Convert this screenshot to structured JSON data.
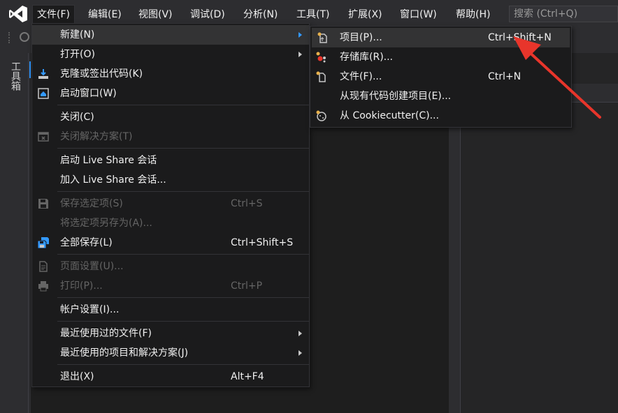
{
  "menubar": {
    "items": [
      "文件(F)",
      "编辑(E)",
      "视图(V)",
      "调试(D)",
      "分析(N)",
      "工具(T)",
      "扩展(X)",
      "窗口(W)",
      "帮助(H)"
    ],
    "search_placeholder": "搜索 (Ctrl+Q)"
  },
  "sidebar": {
    "toolbox_label": "工具箱"
  },
  "file_menu": {
    "items": [
      {
        "label": "新建(N)",
        "shortcut": ""
      },
      {
        "label": "打开(O)",
        "shortcut": ""
      },
      {
        "label": "克隆或签出代码(K)",
        "shortcut": ""
      },
      {
        "label": "启动窗口(W)",
        "shortcut": ""
      },
      {
        "label": "关闭(C)",
        "shortcut": ""
      },
      {
        "label": "关闭解决方案(T)",
        "shortcut": ""
      },
      {
        "label": "启动 Live Share 会话",
        "shortcut": ""
      },
      {
        "label": "加入 Live Share 会话...",
        "shortcut": ""
      },
      {
        "label": "保存选定项(S)",
        "shortcut": "Ctrl+S"
      },
      {
        "label": "将选定项另存为(A)...",
        "shortcut": ""
      },
      {
        "label": "全部保存(L)",
        "shortcut": "Ctrl+Shift+S"
      },
      {
        "label": "页面设置(U)...",
        "shortcut": ""
      },
      {
        "label": "打印(P)...",
        "shortcut": "Ctrl+P"
      },
      {
        "label": "帐户设置(I)...",
        "shortcut": ""
      },
      {
        "label": "最近使用过的文件(F)",
        "shortcut": ""
      },
      {
        "label": "最近使用的项目和解决方案(J)",
        "shortcut": ""
      },
      {
        "label": "退出(X)",
        "shortcut": "Alt+F4"
      }
    ]
  },
  "new_submenu": {
    "items": [
      {
        "label": "项目(P)...",
        "shortcut": "Ctrl+Shift+N"
      },
      {
        "label": "存储库(R)...",
        "shortcut": ""
      },
      {
        "label": "文件(F)...",
        "shortcut": "Ctrl+N"
      },
      {
        "label": "从现有代码创建项目(E)...",
        "shortcut": ""
      },
      {
        "label": "从 Cookiecutter(C)...",
        "shortcut": ""
      }
    ]
  },
  "colors": {
    "accent": "#3399ff",
    "menu_bg": "#1b1b1c",
    "highlight_bg": "#333334",
    "disabled_text": "#656565",
    "annotation_arrow": "#e8352b",
    "logo": "#ffffff"
  },
  "icons": {
    "logo": "visual-studio-logo-icon",
    "toolbar": "nav-back-icon"
  }
}
